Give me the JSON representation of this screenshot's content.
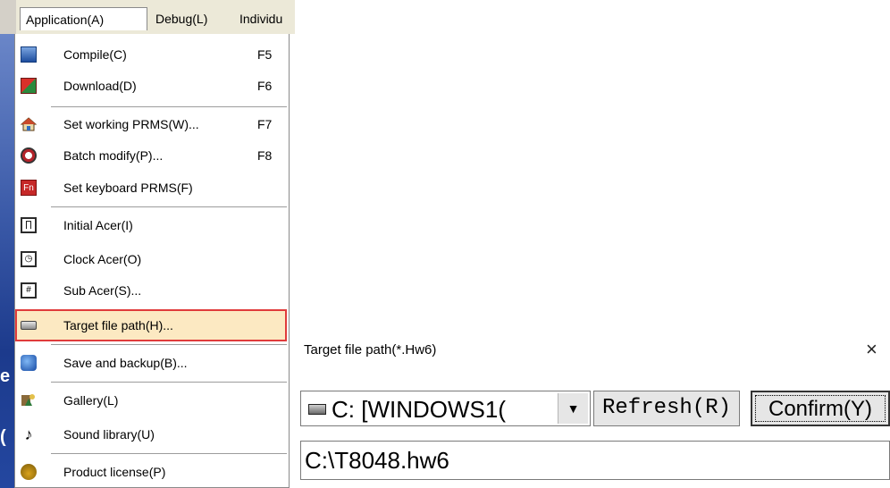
{
  "menubar": {
    "application": "Application(A)",
    "debug": "Debug(L)",
    "individual": "Individu"
  },
  "menu": {
    "items": [
      {
        "label": "Compile(C)",
        "shortcut": "F5",
        "icon": "compile-icon"
      },
      {
        "label": "Download(D)",
        "shortcut": "F6",
        "icon": "download-icon"
      },
      {
        "label": "Set working PRMS(W)...",
        "shortcut": "F7",
        "icon": "home-icon"
      },
      {
        "label": "Batch modify(P)...",
        "shortcut": "F8",
        "icon": "batch-modify-icon"
      },
      {
        "label": "Set keyboard PRMS(F)",
        "shortcut": "",
        "icon": "fn-key-icon"
      },
      {
        "label": "Initial Acer(I)",
        "shortcut": "",
        "icon": "initial-acer-icon"
      },
      {
        "label": "Clock Acer(O)",
        "shortcut": "",
        "icon": "clock-acer-icon"
      },
      {
        "label": "Sub Acer(S)...",
        "shortcut": "",
        "icon": "sub-acer-icon"
      },
      {
        "label": "Target file path(H)...",
        "shortcut": "",
        "icon": "drive-icon"
      },
      {
        "label": "Save and backup(B)...",
        "shortcut": "",
        "icon": "save-icon"
      },
      {
        "label": "Gallery(L)",
        "shortcut": "",
        "icon": "gallery-icon"
      },
      {
        "label": "Sound library(U)",
        "shortcut": "",
        "icon": "music-note-icon"
      },
      {
        "label": "Product license(P)",
        "shortcut": "",
        "icon": "license-icon"
      }
    ],
    "highlight_color": "#e03b3b"
  },
  "dialog": {
    "title": "Target file path(*.Hw6)",
    "close": "×",
    "drive": "C: [WINDOWS1(",
    "refresh": "Refresh(R)",
    "confirm": "Confirm(Y)",
    "path": "C:\\T8048.hw6"
  }
}
